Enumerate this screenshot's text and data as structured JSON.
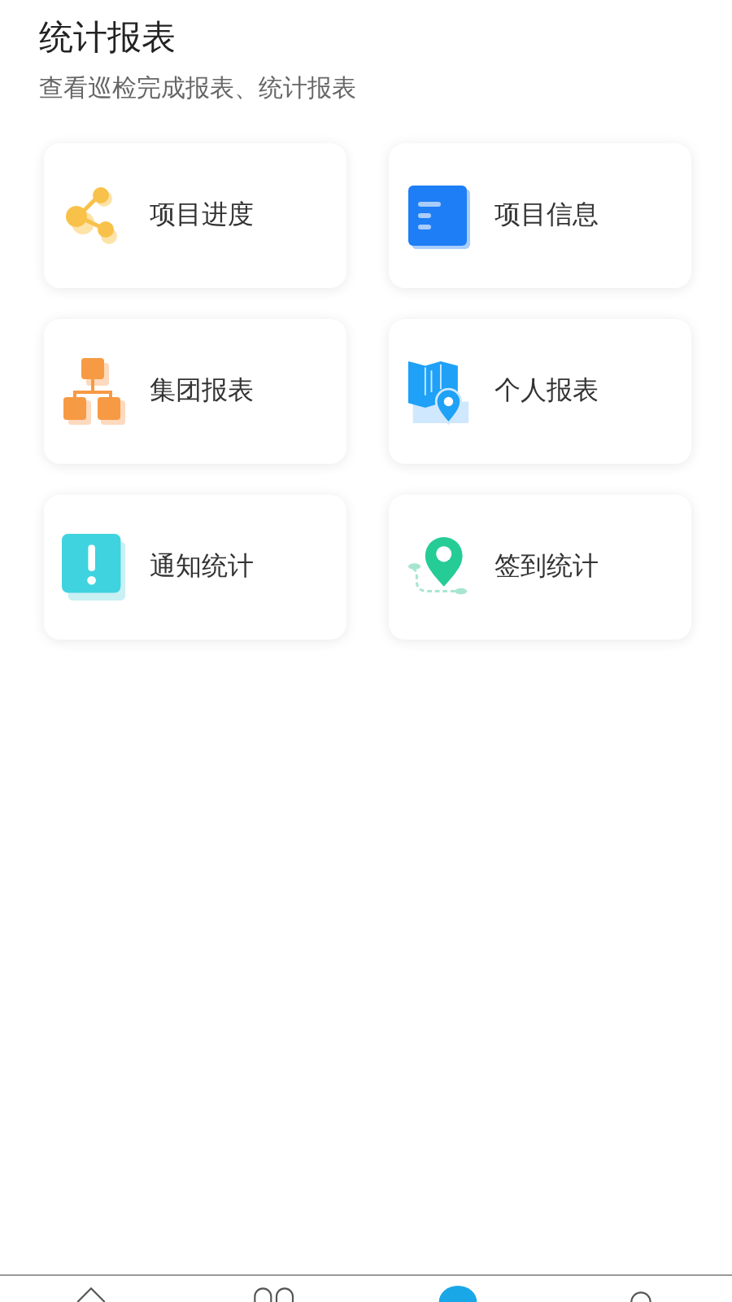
{
  "header": {
    "title": "统计报表",
    "subtitle": "查看巡检完成报表、统计报表"
  },
  "cards": [
    {
      "kind": "share",
      "label": "项目进度"
    },
    {
      "kind": "document",
      "label": "项目信息"
    },
    {
      "kind": "hierarchy",
      "label": "集团报表"
    },
    {
      "kind": "map",
      "label": "个人报表"
    },
    {
      "kind": "alert",
      "label": "通知统计"
    },
    {
      "kind": "pin",
      "label": "签到统计"
    }
  ],
  "tab_bar": {
    "tabs": [
      {
        "kind": "home",
        "selected": false
      },
      {
        "kind": "people",
        "selected": false
      },
      {
        "kind": "dot",
        "selected": true
      },
      {
        "kind": "person",
        "selected": false
      }
    ]
  }
}
